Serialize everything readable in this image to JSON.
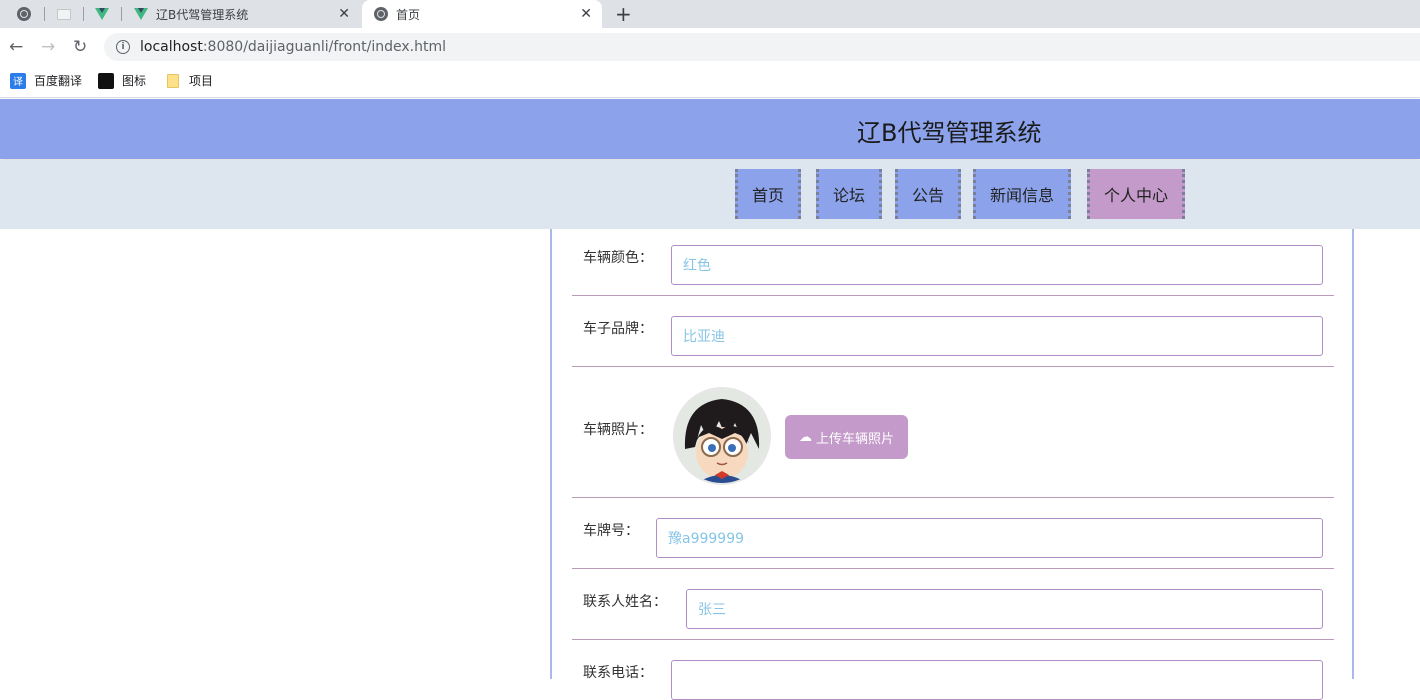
{
  "browser": {
    "tabs": [
      {
        "title": "辽B代驾管理系统",
        "close": "✕"
      },
      {
        "title": "首页",
        "close": "✕"
      }
    ],
    "new_tab": "+",
    "url_host": "localhost",
    "url_path": ":8080/daijiaguanli/front/index.html",
    "bookmarks": [
      {
        "label": "百度翻译",
        "icon_text": "译"
      },
      {
        "label": "图标"
      },
      {
        "label": "项目"
      }
    ]
  },
  "site": {
    "title": "辽B代驾管理系统",
    "nav": [
      "首页",
      "论坛",
      "公告",
      "新闻信息",
      "个人中心"
    ],
    "active_nav": "个人中心"
  },
  "form": {
    "color": {
      "label": "车辆颜色：",
      "value": "红色"
    },
    "brand": {
      "label": "车子品牌：",
      "value": "比亚迪"
    },
    "photo": {
      "label": "车辆照片：",
      "upload_label": "上传车辆照片"
    },
    "plate": {
      "label": "车牌号：",
      "value": "豫a999999"
    },
    "contact_name": {
      "label": "联系人姓名：",
      "value": "张三"
    },
    "contact_phone": {
      "label": "联系电话："
    }
  },
  "colors": {
    "header": "#8ca3ec",
    "nav_bg": "#dde6ef",
    "accent": "#c39ac9",
    "input_text": "#86c5e6"
  }
}
